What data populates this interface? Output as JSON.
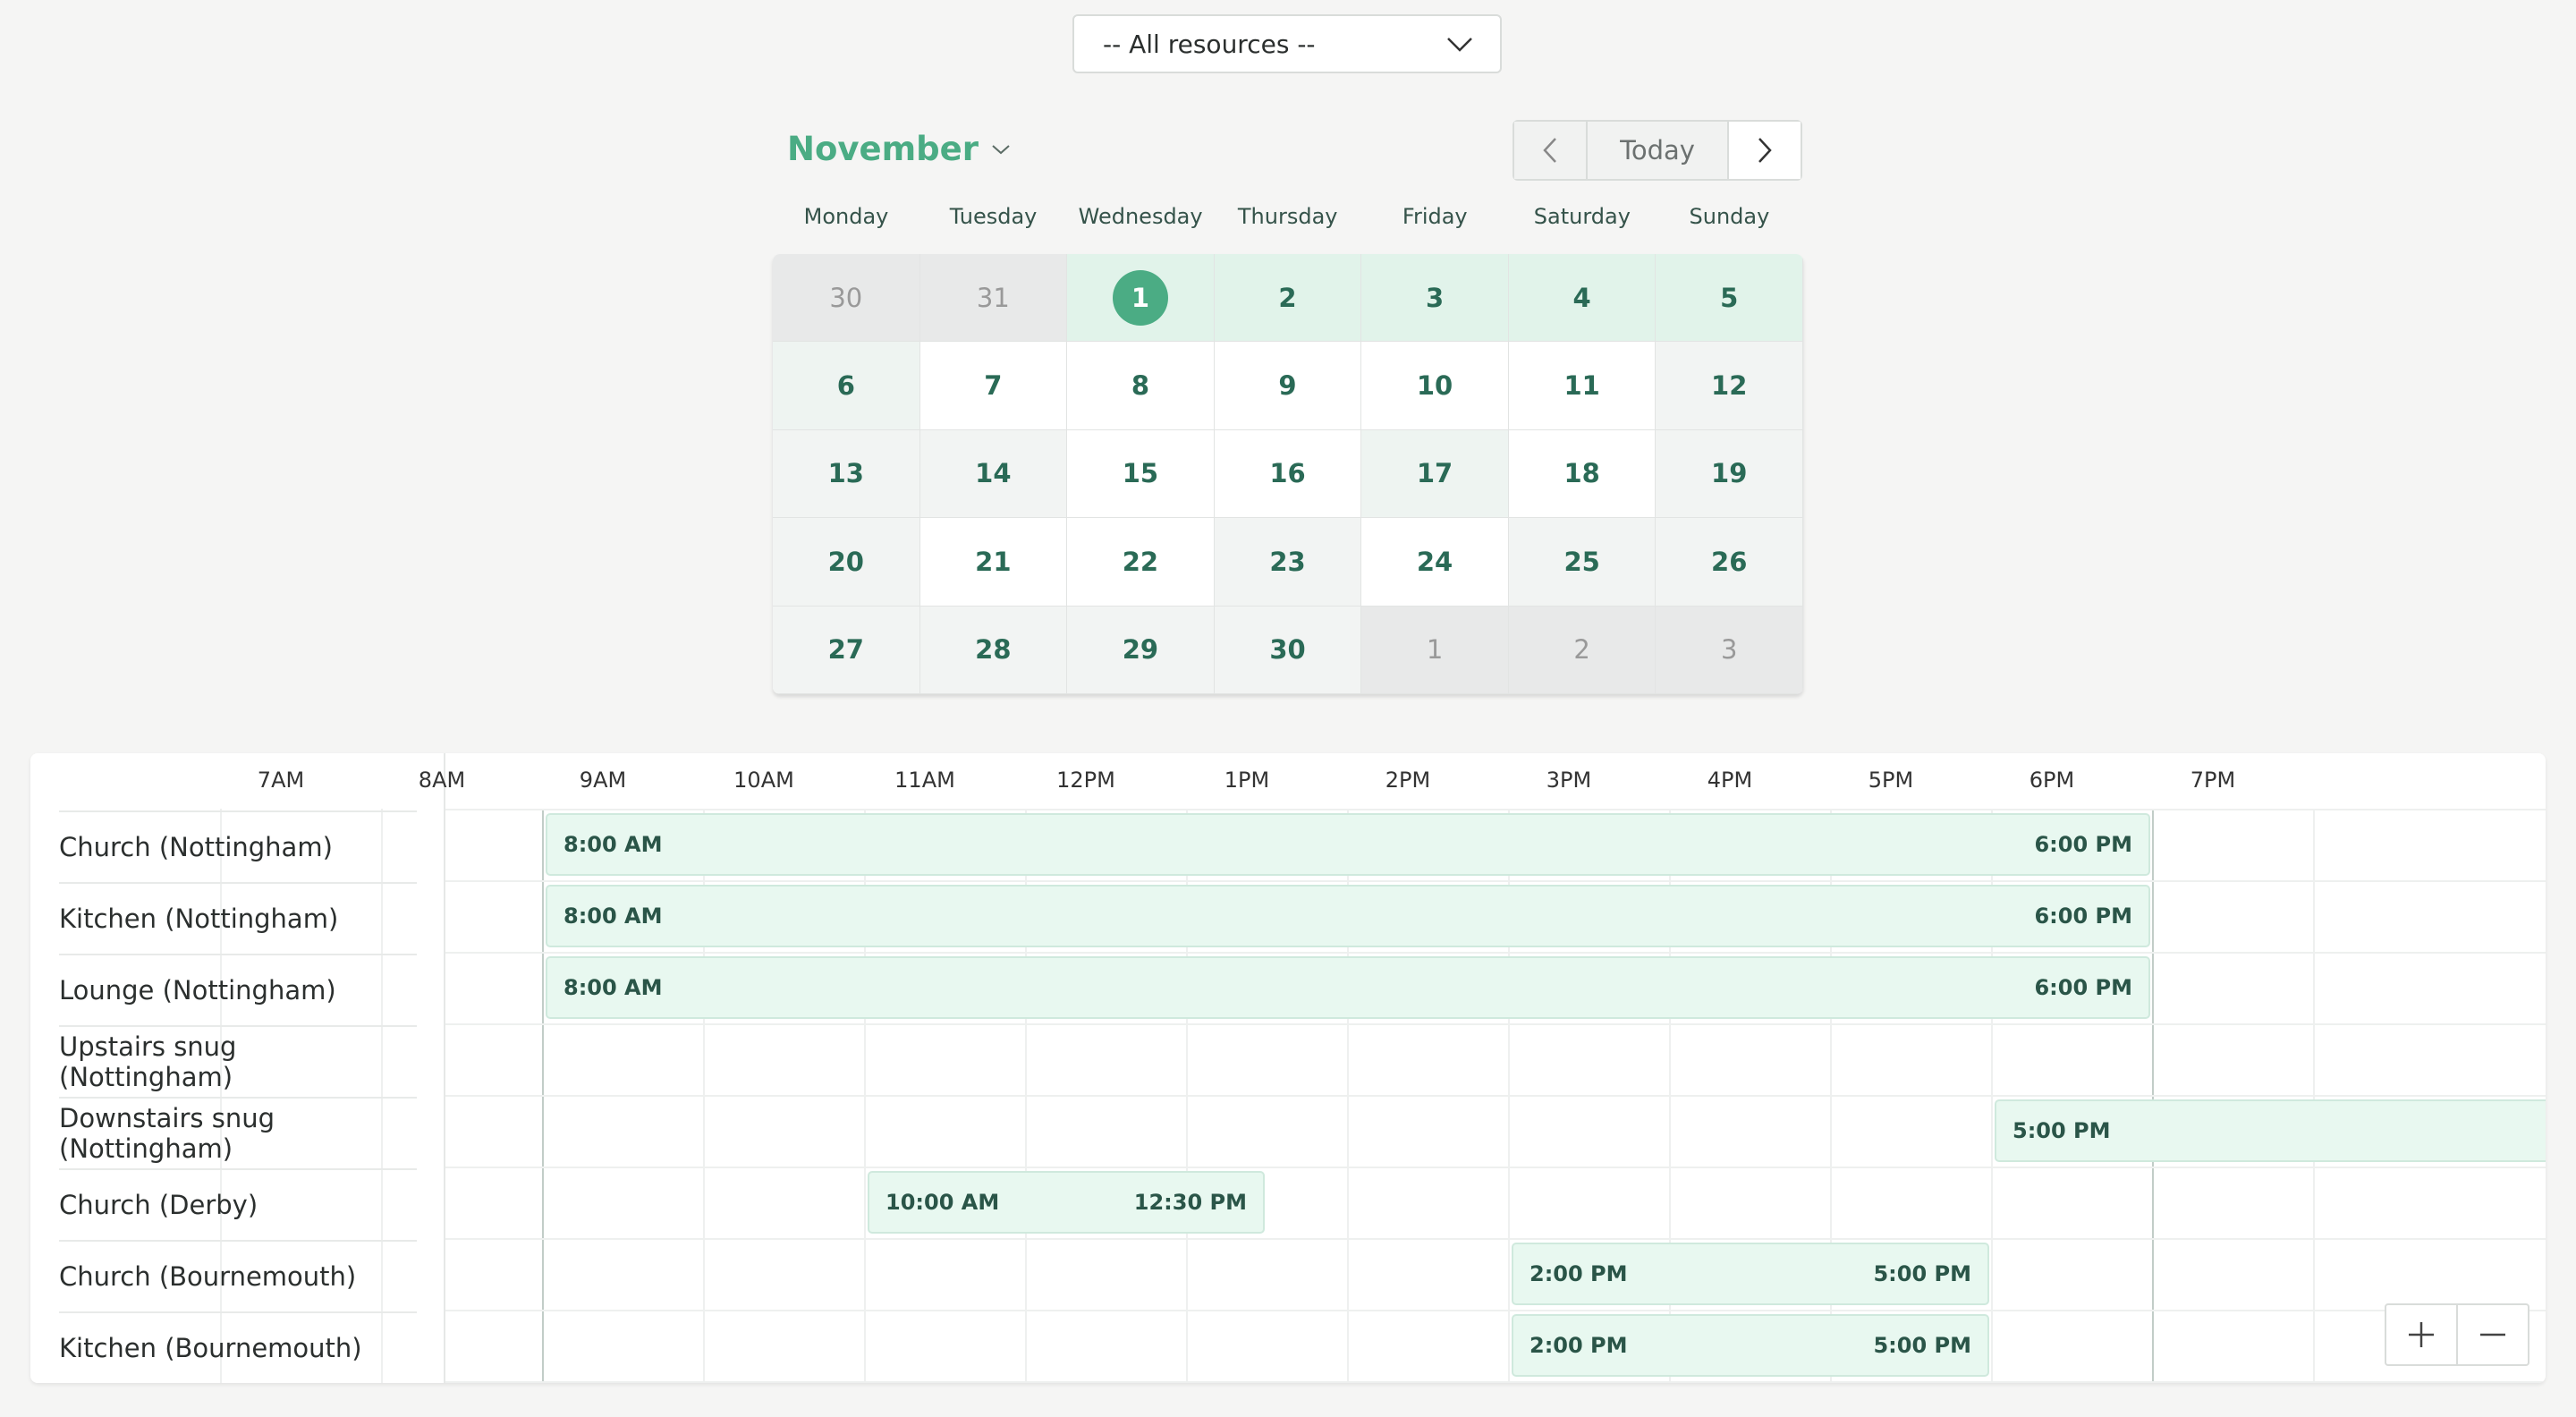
{
  "resource_select": {
    "value": "-- All resources --"
  },
  "calendar": {
    "month_label": "November",
    "today_label": "Today",
    "weekdays": [
      "Monday",
      "Tuesday",
      "Wednesday",
      "Thursday",
      "Friday",
      "Saturday",
      "Sunday"
    ],
    "weeks": [
      [
        "30",
        "31",
        "1",
        "2",
        "3",
        "4",
        "5"
      ],
      [
        "6",
        "7",
        "8",
        "9",
        "10",
        "11",
        "12"
      ],
      [
        "13",
        "14",
        "15",
        "16",
        "17",
        "18",
        "19"
      ],
      [
        "20",
        "21",
        "22",
        "23",
        "24",
        "25",
        "26"
      ],
      [
        "27",
        "28",
        "29",
        "30",
        "1",
        "2",
        "3"
      ]
    ],
    "selected_day": "1",
    "accent_color": "#4bac84"
  },
  "timeline": {
    "hours": [
      "7AM",
      "8AM",
      "9AM",
      "10AM",
      "11AM",
      "12PM",
      "1PM",
      "2PM",
      "3PM",
      "4PM",
      "5PM",
      "6PM",
      "7PM"
    ],
    "resources": [
      "Church (Nottingham)",
      "Kitchen (Nottingham)",
      "Lounge (Nottingham)",
      "Upstairs snug (Nottingham)",
      "Downstairs snug (Nottingham)",
      "Church (Derby)",
      "Church (Bournemouth)",
      "Kitchen (Bournemouth)"
    ],
    "events": [
      {
        "resource": 0,
        "start": "8:00 AM",
        "end": "6:00 PM"
      },
      {
        "resource": 1,
        "start": "8:00 AM",
        "end": "6:00 PM"
      },
      {
        "resource": 2,
        "start": "8:00 AM",
        "end": "6:00 PM"
      },
      {
        "resource": 4,
        "start": "5:00 PM",
        "end": ""
      },
      {
        "resource": 5,
        "start": "10:00 AM",
        "end": "12:30 PM"
      },
      {
        "resource": 6,
        "start": "2:00 PM",
        "end": "5:00 PM"
      },
      {
        "resource": 7,
        "start": "2:00 PM",
        "end": "5:00 PM"
      }
    ]
  },
  "zoom": {
    "in_icon": "plus-icon",
    "out_icon": "minus-icon"
  }
}
